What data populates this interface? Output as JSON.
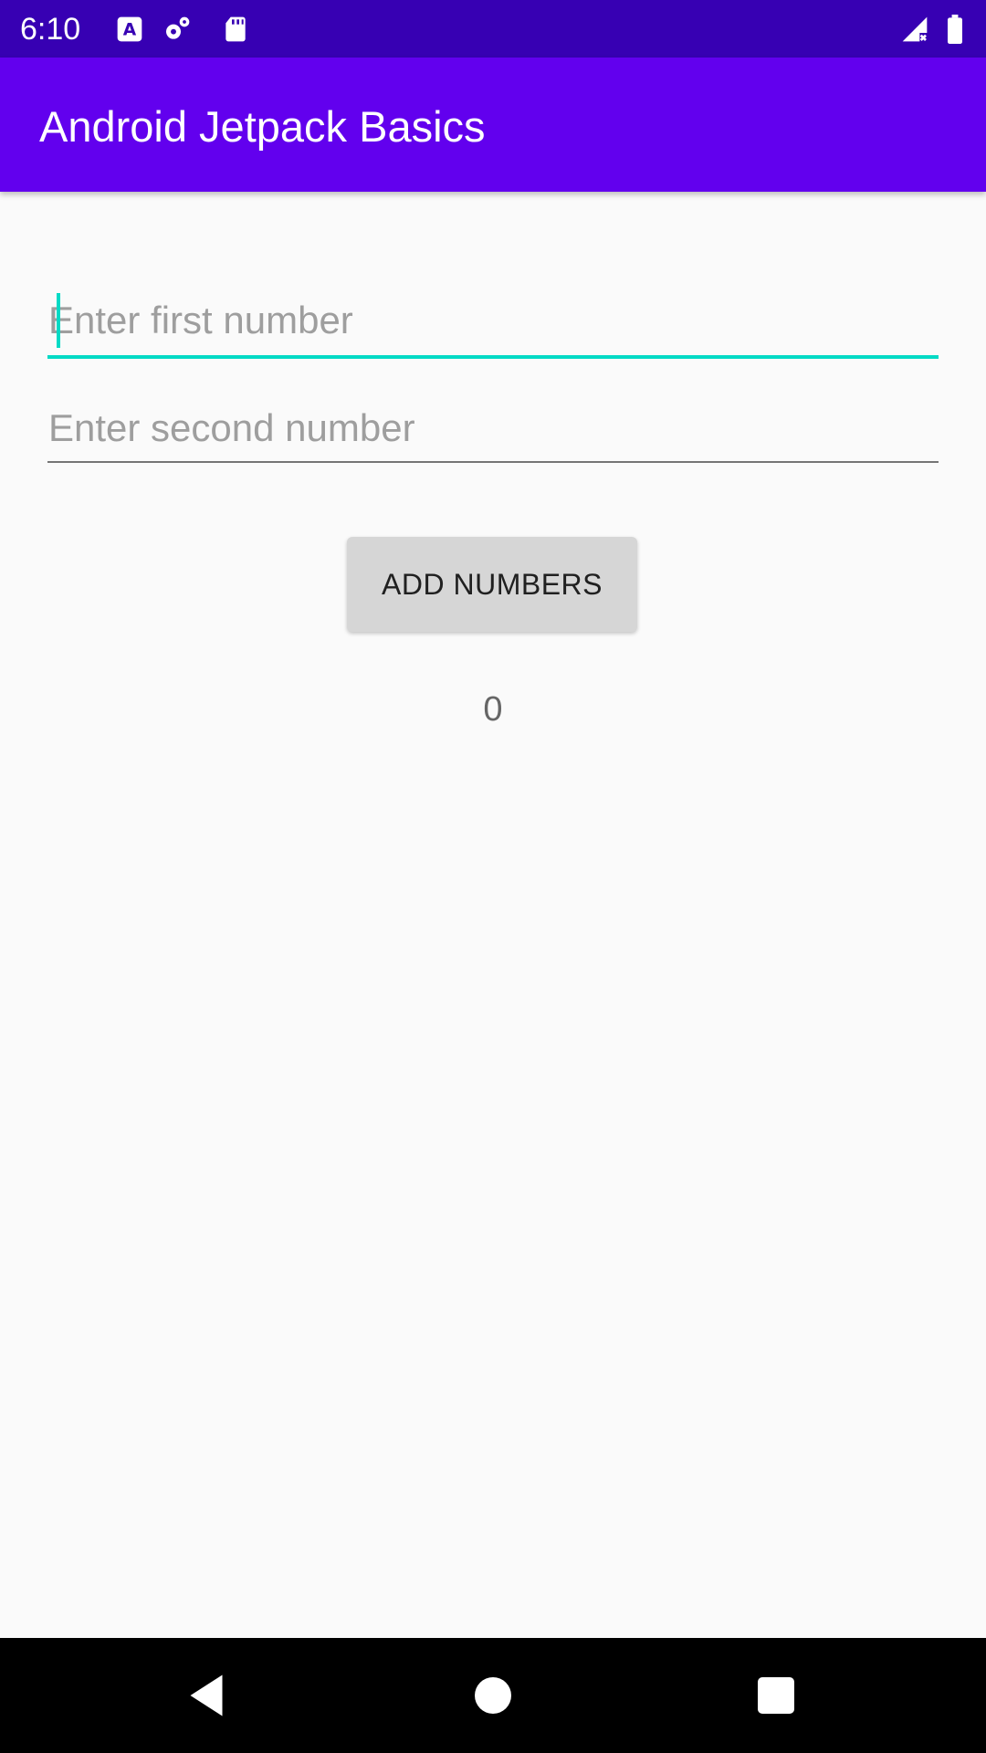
{
  "status_bar": {
    "time": "6:10",
    "icons": [
      "a-notification-icon",
      "settings-notification-icon",
      "sd-card-icon",
      "signal-no-data-icon",
      "battery-icon"
    ],
    "background": "#3700b3"
  },
  "app_bar": {
    "title": "Android Jetpack Basics",
    "background": "#6200ee"
  },
  "form": {
    "first_number": {
      "value": "",
      "placeholder": "Enter first number",
      "focused": true,
      "accent": "#03dac5"
    },
    "second_number": {
      "value": "",
      "placeholder": "Enter second number"
    },
    "add_button_label": "ADD NUMBERS",
    "result": "0"
  },
  "nav_bar": {
    "buttons": [
      "back-icon",
      "home-icon",
      "recents-icon"
    ]
  }
}
